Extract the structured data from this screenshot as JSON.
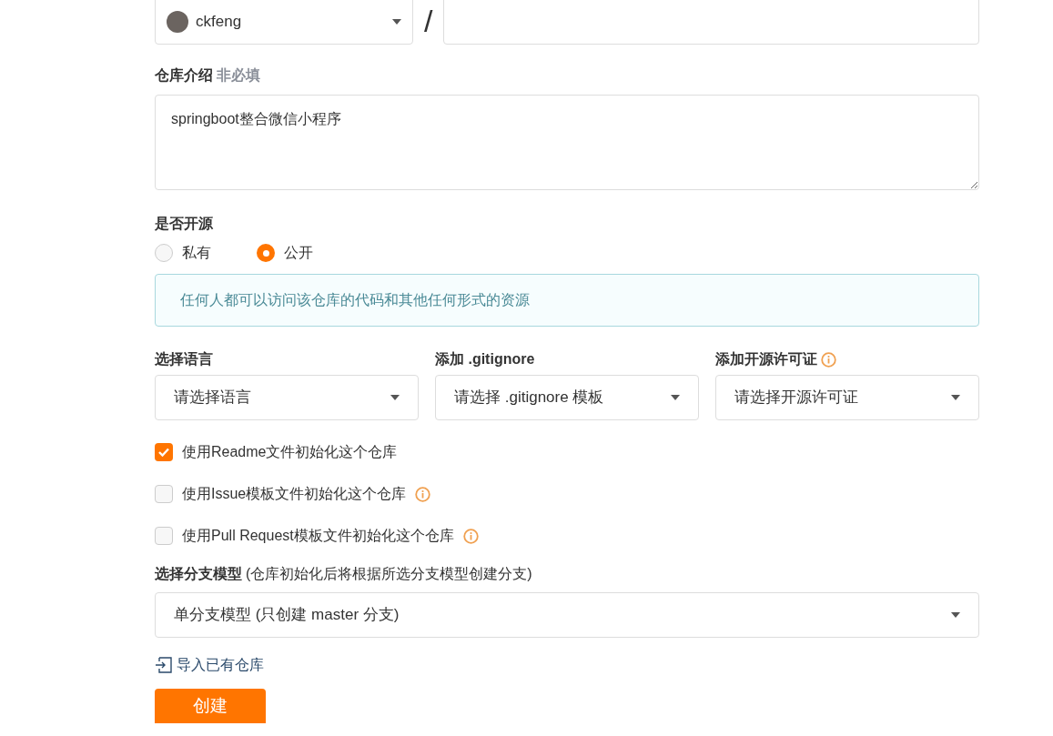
{
  "owner": {
    "name": "ckfeng"
  },
  "separator": "/",
  "description": {
    "label": "仓库介绍",
    "hint": "非必填",
    "value": "springboot整合微信小程序"
  },
  "open_source": {
    "label": "是否开源",
    "options": [
      {
        "label": "私有",
        "selected": false
      },
      {
        "label": "公开",
        "selected": true
      }
    ]
  },
  "notice": "任何人都可以访问该仓库的代码和其他任何形式的资源",
  "selects": [
    {
      "label": "选择语言",
      "value": "请选择语言",
      "info": false
    },
    {
      "label": "添加 .gitignore",
      "value": "请选择 .gitignore 模板",
      "info": false
    },
    {
      "label": "添加开源许可证",
      "value": "请选择开源许可证",
      "info": true
    }
  ],
  "checkboxes": [
    {
      "label": "使用Readme文件初始化这个仓库",
      "checked": true,
      "info": false
    },
    {
      "label": "使用Issue模板文件初始化这个仓库",
      "checked": false,
      "info": true
    },
    {
      "label": "使用Pull Request模板文件初始化这个仓库",
      "checked": false,
      "info": true
    }
  ],
  "branch_model": {
    "label": "选择分支模型",
    "hint": "(仓库初始化后将根据所选分支模型创建分支)",
    "value": "单分支模型 (只创建 master 分支)"
  },
  "import_link": "导入已有仓库",
  "submit": "创建"
}
